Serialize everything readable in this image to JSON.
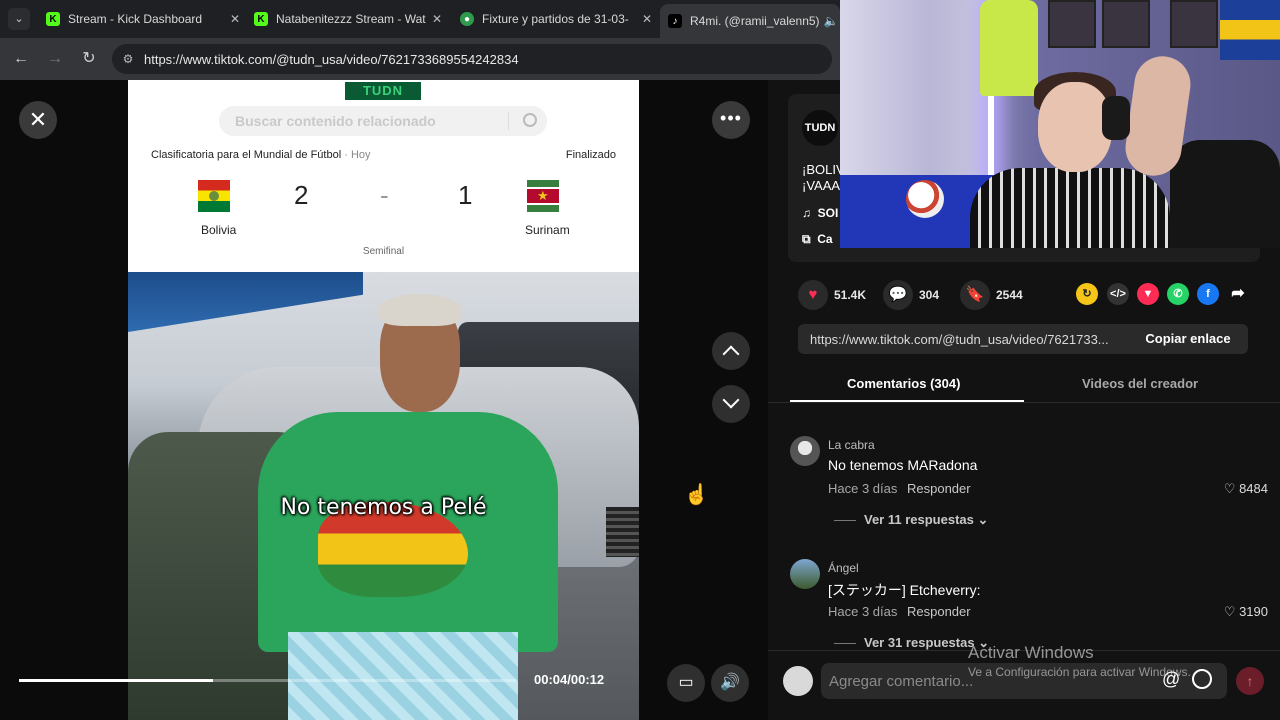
{
  "browser": {
    "tabs": [
      {
        "label": "Stream - Kick Dashboard",
        "favicon": "kick-icon",
        "active": false
      },
      {
        "label": "Natabenitezzz Stream - Wat",
        "favicon": "kick-icon",
        "active": false
      },
      {
        "label": "Fixture y partidos de 31-03-",
        "favicon": "globe-icon",
        "active": false
      },
      {
        "label": "R4mi. (@ramii_valenn5)",
        "favicon": "tiktok-icon",
        "active": true
      }
    ],
    "url": "https://www.tiktok.com/@tudn_usa/video/7621733689554242834",
    "colors": {
      "kick": "#53fc18",
      "tab_bg": "#1f2023",
      "toolbar_bg": "#35363a"
    }
  },
  "video": {
    "search_placeholder": "Buscar contenido relacionado",
    "brand": "TUDN",
    "match": {
      "competition": "Clasificatoria para el Mundial de Fútbol",
      "when": "· Hoy",
      "status": "Finalizado",
      "home_team": "Bolivia",
      "away_team": "Surinam",
      "home_score": "2",
      "separator": "-",
      "away_score": "1",
      "stage": "Semifinal"
    },
    "caption": "No tenemos a Pelé",
    "time": "00:04/00:12",
    "progress": 0.39
  },
  "panel": {
    "account_initials": "TUDN",
    "description_lines": [
      "¡BOLIV",
      "¡VAAA"
    ],
    "sound_line": "SOI",
    "category_line": "Ca",
    "stats": {
      "likes": "51.4K",
      "comments": "304",
      "saves": "2544"
    },
    "share_url": "https://www.tiktok.com/@tudn_usa/video/7621733...",
    "copy_label": "Copiar enlace",
    "tabs": {
      "comments": "Comentarios (304)",
      "creator": "Videos del creador"
    },
    "comments": [
      {
        "user": "La cabra",
        "text": "No tenemos MARadona",
        "age": "Hace 3 días",
        "reply": "Responder",
        "likes": "8484",
        "more": "Ver 11 respuestas"
      },
      {
        "user": "Ángel",
        "text": "[ステッカー] Etcheverry:",
        "age": "Hace 3 días",
        "reply": "Responder",
        "likes": "3190",
        "more": "Ver 31 respuestas"
      }
    ],
    "comment_placeholder": "Agregar comentario...",
    "windows_watermark": "Activar Windows",
    "windows_sub": "Ve a Configuración para activar Windows."
  }
}
